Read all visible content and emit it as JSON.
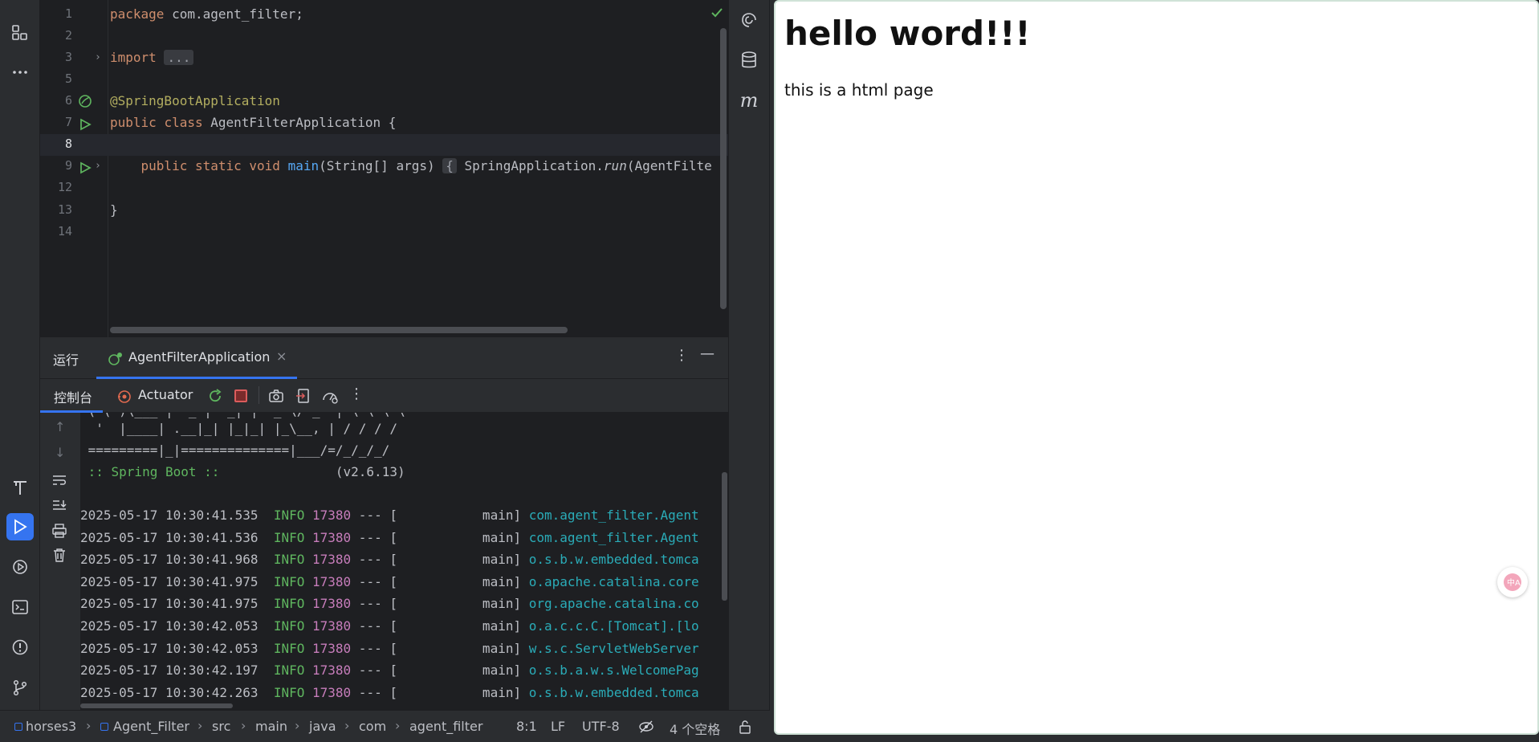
{
  "left_strip": {
    "icons": [
      "project-icon",
      "more-icon",
      "build-icon",
      "run-icon",
      "services-icon",
      "terminal-icon",
      "problems-icon",
      "git-icon"
    ]
  },
  "editor": {
    "lines": [
      {
        "num": "1",
        "text": "package com.agent_filter;"
      },
      {
        "num": "2",
        "text": ""
      },
      {
        "num": "3",
        "text": "import ..."
      },
      {
        "num": "5",
        "text": ""
      },
      {
        "num": "6",
        "text": "@SpringBootApplication"
      },
      {
        "num": "7",
        "text": "public class AgentFilterApplication {"
      },
      {
        "num": "8",
        "text": ""
      },
      {
        "num": "9",
        "text": "    public static void main(String[] args) { SpringApplication.run(AgentFilte"
      },
      {
        "num": "12",
        "text": ""
      },
      {
        "num": "13",
        "text": "}"
      },
      {
        "num": "14",
        "text": ""
      }
    ],
    "tokens": {
      "package_kw": "package",
      "package_name": " com.agent_filter;",
      "import_kw": "import",
      "import_fold": "...",
      "annotation": "@SpringBootApplication",
      "public_kw": "public",
      "class_kw": "class",
      "class_name": " AgentFilterApplication {",
      "static_kw": "static",
      "void_kw": "void",
      "main_fn": "main",
      "main_args": "(String[] args)",
      "brace_fold": "{",
      "spring_app": " SpringApplication.",
      "run_fn": "run",
      "run_args": "(AgentFilte",
      "close_brace": "}"
    }
  },
  "run_panel": {
    "tab_run": "运行",
    "tab_app": "AgentFilterApplication",
    "tab_console": "控制台",
    "tab_actuator": "Actuator",
    "banner": [
      "  '  |____| .__|_| |_|_| |_\\__, | / / / /",
      " =========|_|==============|___/=/_/_/_/"
    ],
    "spring_label": " :: Spring Boot :: ",
    "spring_version": "              (v2.6.13)",
    "log_lines": [
      {
        "ts": "2025-05-17 10:30:41.535",
        "level": "INFO",
        "pid": "17380",
        "mid": " --- [           main] ",
        "logger": "com.agent_filter.Agent"
      },
      {
        "ts": "2025-05-17 10:30:41.536",
        "level": "INFO",
        "pid": "17380",
        "mid": " --- [           main] ",
        "logger": "com.agent_filter.Agent"
      },
      {
        "ts": "2025-05-17 10:30:41.968",
        "level": "INFO",
        "pid": "17380",
        "mid": " --- [           main] ",
        "logger": "o.s.b.w.embedded.tomca"
      },
      {
        "ts": "2025-05-17 10:30:41.975",
        "level": "INFO",
        "pid": "17380",
        "mid": " --- [           main] ",
        "logger": "o.apache.catalina.core"
      },
      {
        "ts": "2025-05-17 10:30:41.975",
        "level": "INFO",
        "pid": "17380",
        "mid": " --- [           main] ",
        "logger": "org.apache.catalina.co"
      },
      {
        "ts": "2025-05-17 10:30:42.053",
        "level": "INFO",
        "pid": "17380",
        "mid": " --- [           main] ",
        "logger": "o.a.c.c.C.[Tomcat].[lo"
      },
      {
        "ts": "2025-05-17 10:30:42.053",
        "level": "INFO",
        "pid": "17380",
        "mid": " --- [           main] ",
        "logger": "w.s.c.ServletWebServer"
      },
      {
        "ts": "2025-05-17 10:30:42.197",
        "level": "INFO",
        "pid": "17380",
        "mid": " --- [           main] ",
        "logger": "o.s.b.a.w.s.WelcomePag"
      },
      {
        "ts": "2025-05-17 10:30:42.263",
        "level": "INFO",
        "pid": "17380",
        "mid": " --- [           main] ",
        "logger": "o.s.b.w.embedded.tomca"
      }
    ]
  },
  "status_bar": {
    "crumbs": [
      "horses3",
      "Agent_Filter",
      "src",
      "main",
      "java",
      "com",
      "agent_filter"
    ],
    "position": "8:1",
    "line_sep": "LF",
    "encoding": "UTF-8",
    "indent": "4 个空格"
  },
  "preview": {
    "heading": "hello word!!!",
    "paragraph": "this is a html page"
  },
  "colors": {
    "accent": "#3574f0",
    "keyword": "#cf8e6d",
    "annotation": "#b3ae60",
    "function": "#56a8f5",
    "info": "#5fb65f",
    "pid": "#c77dbb",
    "logger": "#2aacb8"
  }
}
